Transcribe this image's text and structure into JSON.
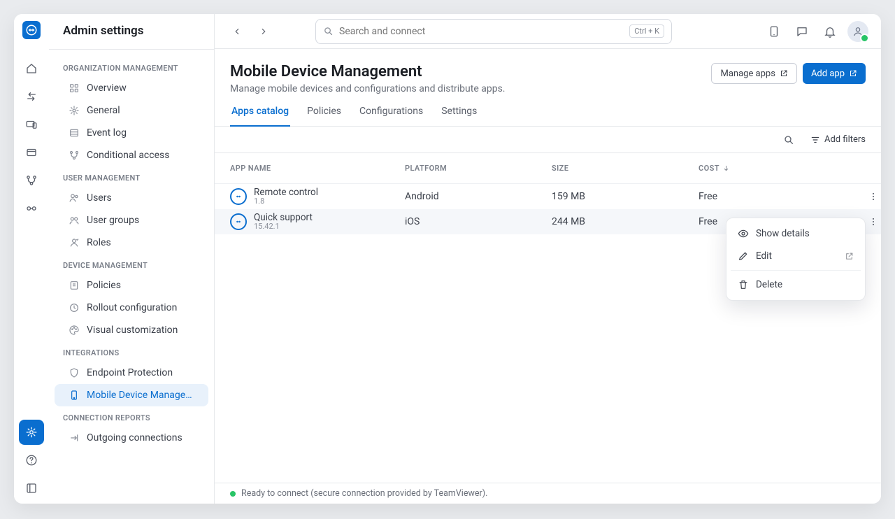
{
  "window_title": "Admin settings",
  "search": {
    "placeholder": "Search and connect",
    "shortcut": "Ctrl + K"
  },
  "rail": {
    "items": [
      "home",
      "transfer",
      "devices",
      "wallet",
      "branch",
      "connected",
      "gear",
      "help",
      "expand"
    ],
    "active_index": 6
  },
  "sidebar": {
    "sections": [
      {
        "label": "ORGANIZATION MANAGEMENT",
        "items": [
          {
            "icon": "grid",
            "label": "Overview"
          },
          {
            "icon": "cog",
            "label": "General"
          },
          {
            "icon": "list",
            "label": "Event log"
          },
          {
            "icon": "branch",
            "label": "Conditional access"
          }
        ]
      },
      {
        "label": "USER MANAGEMENT",
        "items": [
          {
            "icon": "users",
            "label": "Users"
          },
          {
            "icon": "usergroup",
            "label": "User groups"
          },
          {
            "icon": "roles",
            "label": "Roles"
          }
        ]
      },
      {
        "label": "DEVICE MANAGEMENT",
        "items": [
          {
            "icon": "policy",
            "label": "Policies"
          },
          {
            "icon": "rollout",
            "label": "Rollout configuration"
          },
          {
            "icon": "palette",
            "label": "Visual customization"
          }
        ]
      },
      {
        "label": "INTEGRATIONS",
        "items": [
          {
            "icon": "shield",
            "label": "Endpoint Protection"
          },
          {
            "icon": "mobile",
            "label": "Mobile Device Managem...",
            "active": true
          }
        ]
      },
      {
        "label": "CONNECTION REPORTS",
        "items": [
          {
            "icon": "outgoing",
            "label": "Outgoing connections"
          }
        ]
      }
    ]
  },
  "page": {
    "title": "Mobile Device Management",
    "subtitle": "Manage mobile devices and configurations and distribute apps.",
    "actions": {
      "manage_apps": "Manage apps",
      "add_app": "Add app"
    }
  },
  "tabs": [
    {
      "label": "Apps catalog",
      "active": true
    },
    {
      "label": "Policies"
    },
    {
      "label": "Configurations"
    },
    {
      "label": "Settings"
    }
  ],
  "filters": {
    "add_filters_label": "Add filters"
  },
  "table": {
    "columns": [
      "APP NAME",
      "PLATFORM",
      "SIZE",
      "COST"
    ],
    "sort_column_index": 3,
    "sort_direction": "desc",
    "rows": [
      {
        "app": "Remote control",
        "version": "1.8",
        "platform": "Android",
        "size": "159 MB",
        "cost": "Free"
      },
      {
        "app": "Quick support",
        "version": "15.42.1",
        "platform": "iOS",
        "size": "244 MB",
        "cost": "Free",
        "selected": true
      }
    ]
  },
  "context_menu": {
    "items": [
      {
        "icon": "eye",
        "label": "Show details"
      },
      {
        "icon": "pencil",
        "label": "Edit",
        "external": true
      }
    ],
    "danger": {
      "icon": "trash",
      "label": "Delete"
    }
  },
  "status": {
    "text": "Ready to connect (secure connection provided by TeamViewer)."
  },
  "colors": {
    "accent": "#0a6ecf",
    "success": "#28c466"
  }
}
